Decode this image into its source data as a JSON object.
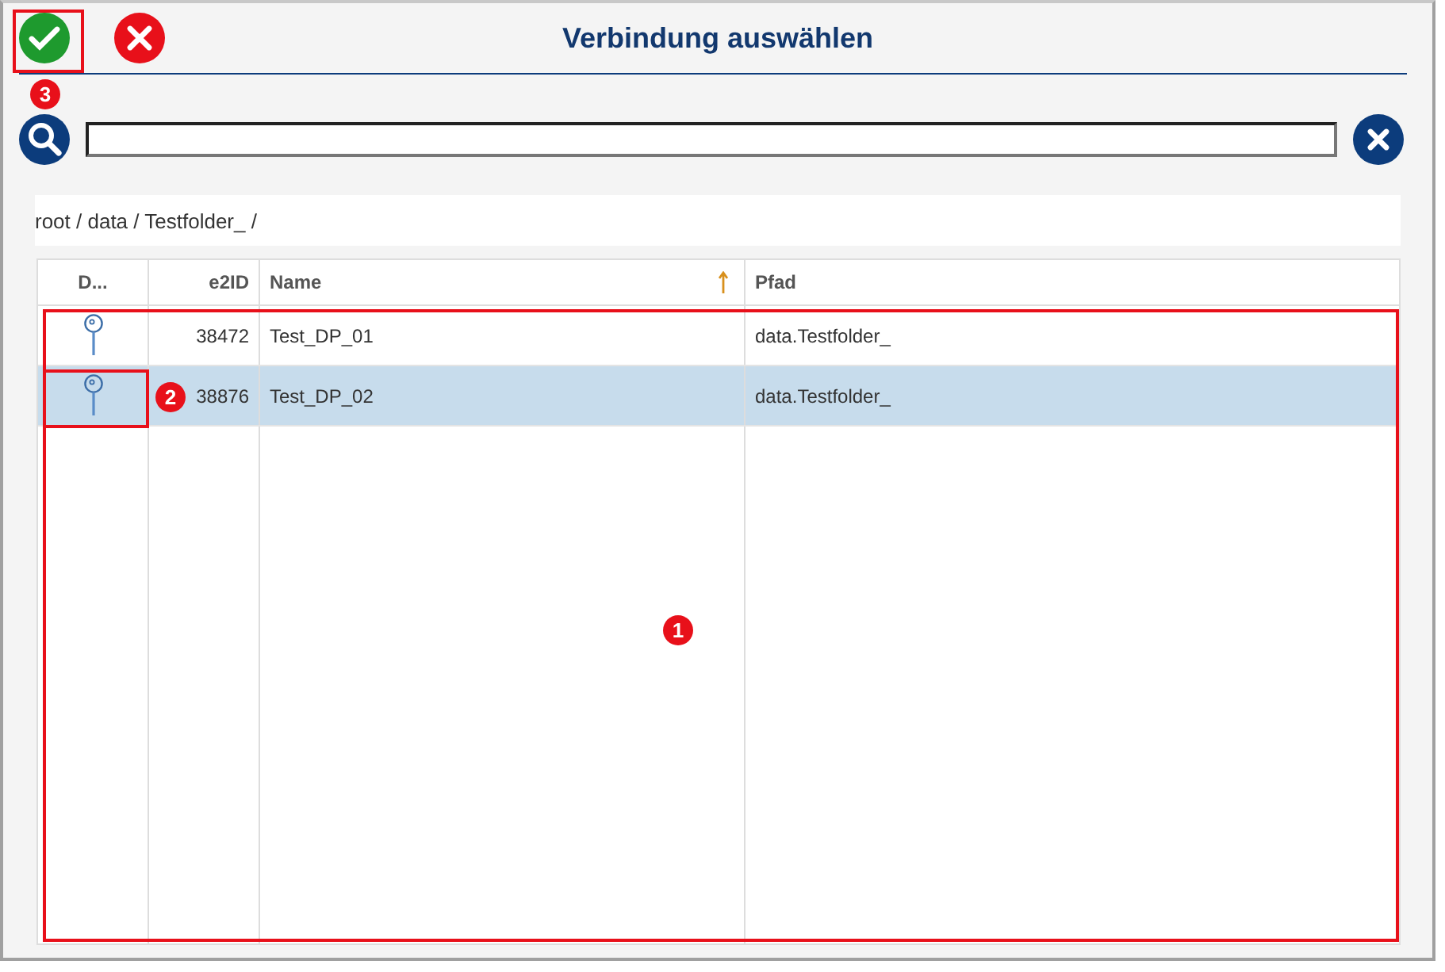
{
  "dialog": {
    "title": "Verbindung auswählen"
  },
  "breadcrumb": "root / data / Testfolder_ /",
  "table": {
    "columns": [
      {
        "label": "D...",
        "sorted": false
      },
      {
        "label": "e2ID",
        "sorted": false
      },
      {
        "label": "Name",
        "sorted": true
      },
      {
        "label": "Pfad",
        "sorted": false
      }
    ],
    "rows": [
      {
        "e2id": "38472",
        "name": "Test_DP_01",
        "path": "data.Testfolder_",
        "selected": false
      },
      {
        "e2id": "38876",
        "name": "Test_DP_02",
        "path": "data.Testfolder_",
        "selected": true
      }
    ]
  },
  "annotations": [
    {
      "number": "1"
    },
    {
      "number": "2"
    },
    {
      "number": "3"
    }
  ]
}
